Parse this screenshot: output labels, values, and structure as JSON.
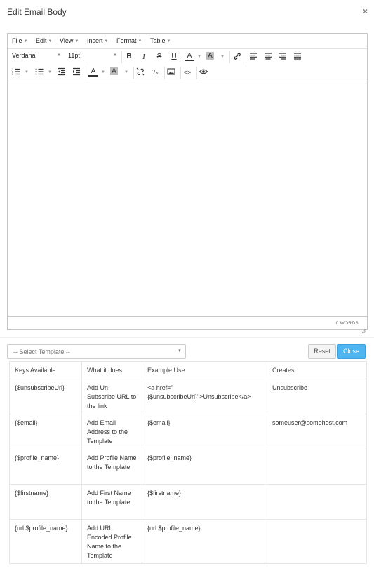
{
  "modal": {
    "title": "Edit Email Body",
    "close_icon": "×"
  },
  "editor": {
    "menus": [
      "File",
      "Edit",
      "View",
      "Insert",
      "Format",
      "Table"
    ],
    "font_family": "Verdana",
    "font_size": "11pt",
    "icons": {
      "bold": "B",
      "italic": "I",
      "strikethrough": "S",
      "underline": "U",
      "text_color": "A",
      "background_color": "A"
    },
    "word_count": "0 WORDS"
  },
  "template": {
    "placeholder": "-- Select Template --",
    "reset_label": "Reset",
    "close_label": "Close"
  },
  "table": {
    "headers": [
      "Keys Available",
      "What it does",
      "Example Use",
      "Creates"
    ],
    "rows": [
      [
        "{$unsubscribeUrl}",
        "Add Un-Subscribe URL to the link",
        "<a href=\"\n{$unsubscribeUrl}\">Unsubscribe</a>",
        "Unsubscribe"
      ],
      [
        "{$email}",
        "Add Email Address to the Template",
        "{$email}",
        "someuser@somehost.com"
      ],
      [
        "{$profile_name}",
        "Add Profile Name to the Template",
        "{$profile_name}",
        ""
      ],
      [
        "{$firstname}",
        "Add First Name to the Template",
        "{$firstname}",
        ""
      ],
      [
        "{url:$profile_name}",
        "Add URL Encoded Profile Name to the Template",
        "{url:$profile_name}",
        ""
      ]
    ]
  },
  "colors": {
    "primary_button": "#4eb5f1",
    "border": "#c5c5c5"
  }
}
